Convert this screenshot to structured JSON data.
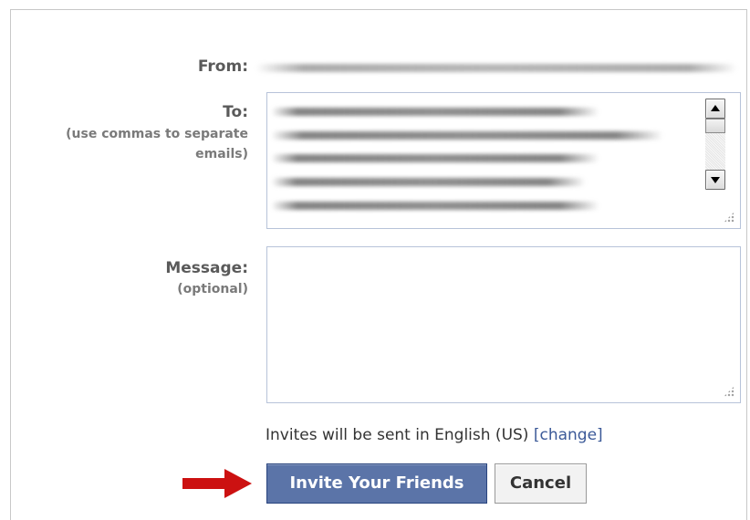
{
  "form": {
    "from_label": "From:",
    "to_label": "To:",
    "to_hint": "(use commas to separate emails)",
    "message_label": "Message:",
    "message_hint": "(optional)",
    "message_value": ""
  },
  "language_notice": {
    "text": "Invites will be sent in English (US)",
    "change_link": "[change]"
  },
  "buttons": {
    "invite_label": "Invite Your Friends",
    "cancel_label": "Cancel"
  },
  "colors": {
    "primary_button": "#5b74a8",
    "link": "#3b5998",
    "arrow": "#cc1111"
  }
}
